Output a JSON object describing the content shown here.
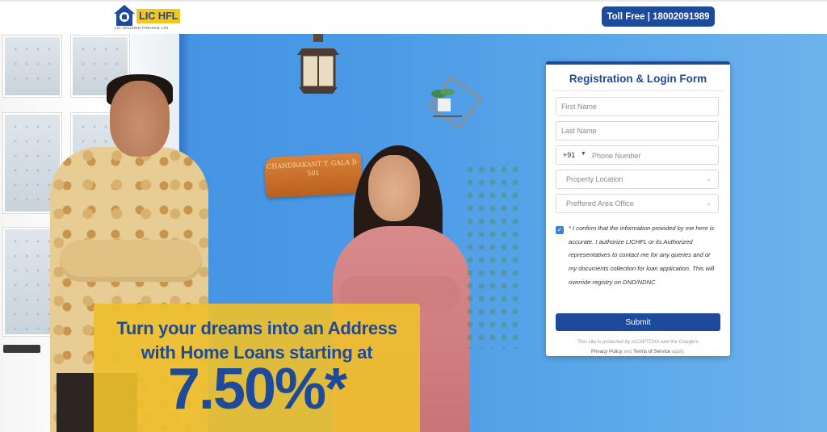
{
  "header": {
    "logo_text": "LIC HFL",
    "logo_sub": "LIC HOUSING FINANCE LTD",
    "toll_free": "Toll Free | 18002091989"
  },
  "hero": {
    "nameplate": "CHANDRAKANT T. GALA B-501",
    "line1": "Turn your dreams into an Address",
    "line2": "with Home Loans starting at",
    "rate": "7.50%*"
  },
  "form": {
    "title": "Registration & Login Form",
    "first_name_placeholder": "First Name",
    "last_name_placeholder": "Last Name",
    "phone_prefix": "+91",
    "phone_placeholder": "Phone Number",
    "property_location": "Property Location",
    "preferred_office": "Preffered Area Office",
    "consent_checked": true,
    "consent_text": "* I confirm that the information provided by me here is accurate. I authorize LICHFL or its Authorized representatives to contact me for any queries and or my documents collection for loan application. This will override registry on DND/NDNC",
    "submit_label": "Submit",
    "recaptcha_prefix": "This site is protected by reCAPTCHA and the Google's",
    "privacy_label": "Privacy Policy",
    "and": "and",
    "terms_label": "Terms of Service",
    "apply": "apply."
  },
  "colors": {
    "brand_blue": "#1d4a9b",
    "brand_yellow": "#f3c623",
    "hero_blue": "#4c9ae6"
  }
}
